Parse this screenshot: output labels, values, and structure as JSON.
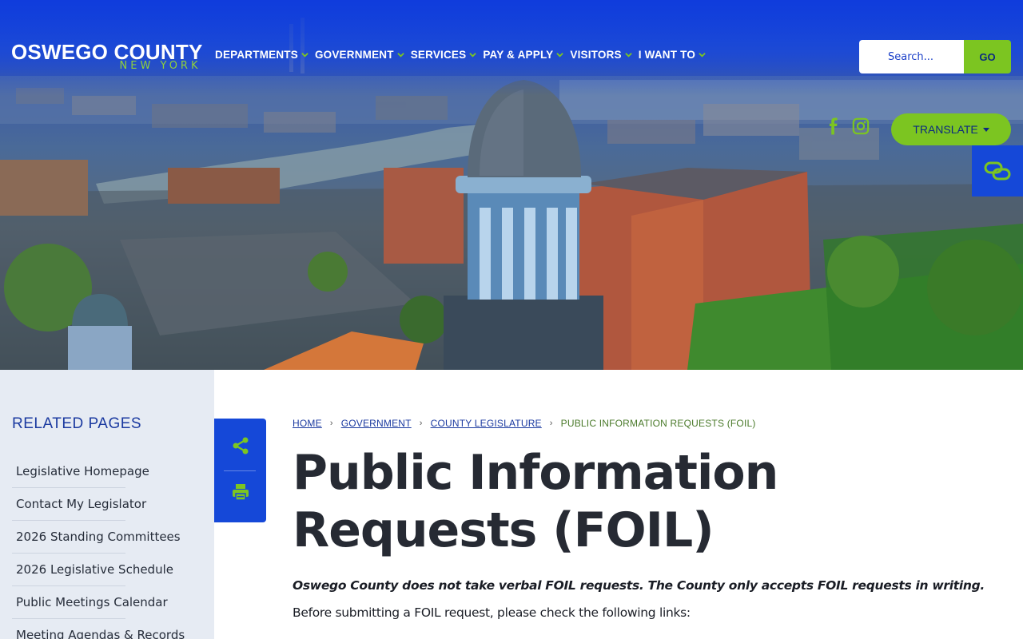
{
  "header": {
    "logo_main": "OSWEGO COUNTY",
    "logo_sub": "NEW YORK",
    "nav": [
      {
        "label": "DEPARTMENTS"
      },
      {
        "label": "GOVERNMENT"
      },
      {
        "label": "SERVICES"
      },
      {
        "label": "PAY & APPLY"
      },
      {
        "label": "VISITORS"
      },
      {
        "label": "I WANT TO"
      }
    ],
    "search_placeholder": "Search...",
    "search_button": "GO",
    "translate_label": "TRANSLATE",
    "social": [
      "facebook-icon",
      "instagram-icon"
    ]
  },
  "colors": {
    "brand_blue": "#1548d8",
    "accent_green": "#7cc521",
    "title_dark": "#262a33",
    "link_blue": "#1b3aa0"
  },
  "sidebar": {
    "title": "RELATED PAGES",
    "items": [
      {
        "label": "Legislative Homepage"
      },
      {
        "label": "Contact My Legislator"
      },
      {
        "label": "2026 Standing Committees"
      },
      {
        "label": "2026 Legislative Schedule"
      },
      {
        "label": "Public Meetings Calendar"
      },
      {
        "label": "Meeting Agendas & Records"
      }
    ]
  },
  "breadcrumb": {
    "items": [
      "HOME",
      "GOVERNMENT",
      "COUNTY LEGISLATURE"
    ],
    "current": "PUBLIC INFORMATION REQUESTS (FOIL)"
  },
  "main": {
    "title_line1": "Public Information",
    "title_line2": "Requests (FOIL)",
    "intro_bold": "Oswego County does not take verbal FOIL requests.  The County only accepts FOIL requests in writing.",
    "intro_text": "Before submitting a FOIL request, please check the following links:"
  }
}
